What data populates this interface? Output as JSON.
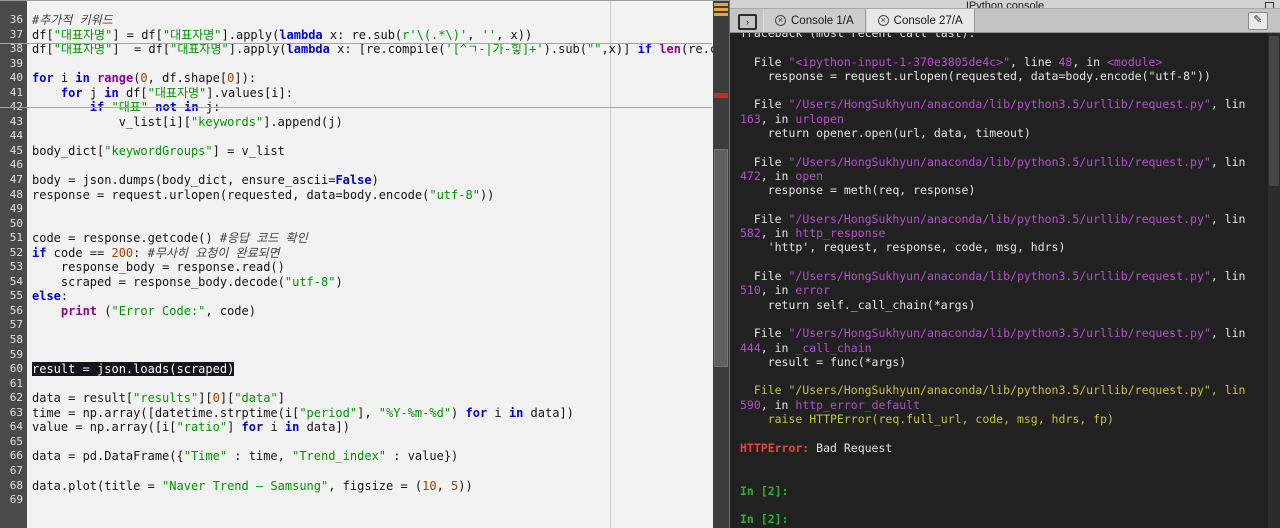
{
  "colors": {
    "ed-bg": "#f2f2f2",
    "ed-gutter-bg": "#4a4a4a",
    "ed-gutter-fg": "#e0e0e0",
    "ed-default": "#141414",
    "ed-keyword": "#0000d0",
    "ed-builtin": "#900090",
    "ed-string": "#009500",
    "ed-number": "#a04000",
    "ed-comment": "#444444",
    "ed-selected-bg": "#14141e",
    "ed-selected-fg": "#ffffff",
    "edge-line": "#cfcfcf",
    "con-bg": "#212121",
    "con-fg": "#e4e4e4",
    "con-magenta": "#b350c9",
    "con-yellow": "#c3c33c",
    "con-red": "#e8453c",
    "con-green": "#2bb52b",
    "titlebar-bg": "#d2d2d2",
    "tabbar-bg": "#c4c4c4",
    "tab-active-bg": "#e7e7e7",
    "tab-inactive-bg": "#cdcdcd",
    "scroll-track": "#3d3d3d",
    "scroll-thumb": "#5f5f5f",
    "warn-orange": "#e8a33d",
    "err-red": "#cc2a2a"
  },
  "editor": {
    "lines": [
      {
        "num": 36,
        "segs": [
          [
            "c",
            "#추가적 키워드"
          ]
        ]
      },
      {
        "num": 37,
        "segs": [
          [
            "d",
            "df["
          ],
          [
            "s",
            "\"대표자명\""
          ],
          [
            "d",
            "] = df["
          ],
          [
            "s",
            "\"대표자명\""
          ],
          [
            "d",
            "].apply("
          ],
          [
            "k",
            "lambda"
          ],
          [
            "d",
            " x: re.sub("
          ],
          [
            "s",
            "r'\\(.*\\)'"
          ],
          [
            "d",
            ", "
          ],
          [
            "s",
            "''"
          ],
          [
            "d",
            ", x))"
          ]
        ]
      },
      {
        "num": 38,
        "segs": [
          [
            "d",
            "df["
          ],
          [
            "s",
            "\"대표자명\""
          ],
          [
            "d",
            "]  = df["
          ],
          [
            "s",
            "\"대표자명\""
          ],
          [
            "d",
            "].apply("
          ],
          [
            "k",
            "lambda"
          ],
          [
            "d",
            " x: [re.compile("
          ],
          [
            "s",
            "'[^ㄱ-|가-힣]+'"
          ],
          [
            "d",
            ").sub("
          ],
          [
            "s",
            "\"\""
          ],
          [
            "d",
            ",x)] "
          ],
          [
            "k",
            "if"
          ],
          [
            "d",
            " "
          ],
          [
            "b",
            "len"
          ],
          [
            "d",
            "(re.c"
          ]
        ]
      },
      {
        "num": 39,
        "segs": []
      },
      {
        "num": 40,
        "segs": [
          [
            "k",
            "for"
          ],
          [
            "d",
            " i "
          ],
          [
            "k",
            "in"
          ],
          [
            "d",
            " "
          ],
          [
            "b",
            "range"
          ],
          [
            "d",
            "("
          ],
          [
            "n",
            "0"
          ],
          [
            "d",
            ", df.shape["
          ],
          [
            "n",
            "0"
          ],
          [
            "d",
            "]):"
          ]
        ]
      },
      {
        "num": 41,
        "segs": [
          [
            "d",
            "    "
          ],
          [
            "k",
            "for"
          ],
          [
            "d",
            " j "
          ],
          [
            "k",
            "in"
          ],
          [
            "d",
            " df["
          ],
          [
            "s",
            "\"대표자명\""
          ],
          [
            "d",
            "].values[i]:"
          ]
        ]
      },
      {
        "num": 42,
        "segs": [
          [
            "d",
            "        "
          ],
          [
            "k",
            "if"
          ],
          [
            "d",
            " "
          ],
          [
            "s",
            "\"대표\""
          ],
          [
            "d",
            " "
          ],
          [
            "k",
            "not"
          ],
          [
            "d",
            " "
          ],
          [
            "k",
            "in"
          ],
          [
            "d",
            " j:"
          ]
        ]
      },
      {
        "num": 43,
        "segs": [
          [
            "d",
            "            v_list[i]["
          ],
          [
            "s",
            "\"keywords\""
          ],
          [
            "d",
            "].append(j)"
          ]
        ]
      },
      {
        "num": 44,
        "segs": []
      },
      {
        "num": 45,
        "segs": [
          [
            "d",
            "body_dict["
          ],
          [
            "s",
            "\"keywordGroups\""
          ],
          [
            "d",
            "] = v_list"
          ]
        ]
      },
      {
        "num": 46,
        "segs": []
      },
      {
        "num": 47,
        "segs": [
          [
            "d",
            "body = json.dumps(body_dict, ensure_ascii="
          ],
          [
            "k",
            "False"
          ],
          [
            "d",
            ")"
          ]
        ]
      },
      {
        "num": 48,
        "segs": [
          [
            "d",
            "response = request.urlopen(requested, data=body.encode("
          ],
          [
            "s",
            "\"utf-8\""
          ],
          [
            "d",
            "))"
          ]
        ]
      },
      {
        "num": 49,
        "segs": []
      },
      {
        "num": 50,
        "segs": []
      },
      {
        "num": 51,
        "segs": [
          [
            "d",
            "code = response.getcode() "
          ],
          [
            "c",
            "#응답 코드 확인"
          ]
        ]
      },
      {
        "num": 52,
        "segs": [
          [
            "k",
            "if"
          ],
          [
            "d",
            " code == "
          ],
          [
            "n",
            "200"
          ],
          [
            "d",
            ": "
          ],
          [
            "c",
            "#무사히 요청이 완료되면"
          ]
        ]
      },
      {
        "num": 53,
        "segs": [
          [
            "d",
            "    response_body = response.read()"
          ]
        ]
      },
      {
        "num": 54,
        "segs": [
          [
            "d",
            "    scraped = response_body.decode("
          ],
          [
            "s",
            "\"utf-8\""
          ],
          [
            "d",
            ")"
          ]
        ]
      },
      {
        "num": 55,
        "segs": [
          [
            "k",
            "else"
          ],
          [
            "d",
            ":"
          ]
        ]
      },
      {
        "num": 56,
        "segs": [
          [
            "d",
            "    "
          ],
          [
            "b",
            "print"
          ],
          [
            "d",
            " ("
          ],
          [
            "s",
            "\"Error Code:\""
          ],
          [
            "d",
            ", code)"
          ]
        ]
      },
      {
        "num": 57,
        "segs": []
      },
      {
        "num": 58,
        "segs": []
      },
      {
        "num": 59,
        "segs": []
      },
      {
        "num": 60,
        "segs": [
          [
            "sel",
            "result = json.loads(scraped)"
          ]
        ]
      },
      {
        "num": 61,
        "segs": []
      },
      {
        "num": 62,
        "segs": [
          [
            "d",
            "data = result["
          ],
          [
            "s",
            "\"results\""
          ],
          [
            "d",
            "]["
          ],
          [
            "n",
            "0"
          ],
          [
            "d",
            "]["
          ],
          [
            "s",
            "\"data\""
          ],
          [
            "d",
            "]"
          ]
        ]
      },
      {
        "num": 63,
        "segs": [
          [
            "d",
            "time = np.array([datetime.strptime(i["
          ],
          [
            "s",
            "\"period\""
          ],
          [
            "d",
            "], "
          ],
          [
            "s",
            "\"%Y-%m-%d\""
          ],
          [
            "d",
            ") "
          ],
          [
            "k",
            "for"
          ],
          [
            "d",
            " i "
          ],
          [
            "k",
            "in"
          ],
          [
            "d",
            " data])"
          ]
        ]
      },
      {
        "num": 64,
        "segs": [
          [
            "d",
            "value = np.array([i["
          ],
          [
            "s",
            "\"ratio\""
          ],
          [
            "d",
            "] "
          ],
          [
            "k",
            "for"
          ],
          [
            "d",
            " i "
          ],
          [
            "k",
            "in"
          ],
          [
            "d",
            " data])"
          ]
        ]
      },
      {
        "num": 65,
        "segs": []
      },
      {
        "num": 66,
        "segs": [
          [
            "d",
            "data = pd.DataFrame({"
          ],
          [
            "s",
            "\"Time\""
          ],
          [
            "d",
            " : time, "
          ],
          [
            "s",
            "\"Trend_index\""
          ],
          [
            "d",
            " : value})"
          ]
        ]
      },
      {
        "num": 67,
        "segs": []
      },
      {
        "num": 68,
        "segs": [
          [
            "d",
            "data.plot(title = "
          ],
          [
            "s",
            "\"Naver Trend – Samsung\""
          ],
          [
            "d",
            ", figsize = ("
          ],
          [
            "n",
            "10"
          ],
          [
            "d",
            ", "
          ],
          [
            "n",
            "5"
          ],
          [
            "d",
            "))"
          ]
        ]
      },
      {
        "num": 69,
        "segs": []
      }
    ]
  },
  "console": {
    "panel_title": "IPython console",
    "tabs": [
      {
        "label": "Console 1/A",
        "active": false
      },
      {
        "label": "Console 27/A",
        "active": true
      }
    ],
    "lines": [
      {
        "clip": true,
        "segs": [
          [
            "w",
            "Traceback (most recent call last):"
          ]
        ]
      },
      {
        "segs": []
      },
      {
        "segs": [
          [
            "w",
            "  File "
          ],
          [
            "m",
            "\"<ipython-input-1-370e3805de4c>\""
          ],
          [
            "w",
            ", line "
          ],
          [
            "m",
            "48"
          ],
          [
            "w",
            ", in "
          ],
          [
            "m",
            "<module>"
          ]
        ]
      },
      {
        "segs": [
          [
            "w",
            "    response = request.urlopen(requested, data=body.encode(\"utf-8\"))"
          ]
        ]
      },
      {
        "segs": []
      },
      {
        "segs": [
          [
            "w",
            "  File "
          ],
          [
            "m",
            "\"/Users/HongSukhyun/anaconda/lib/python3.5/urllib/request.py\""
          ],
          [
            "w",
            ", lin"
          ]
        ]
      },
      {
        "segs": [
          [
            "m",
            "163"
          ],
          [
            "w",
            ", in "
          ],
          [
            "m",
            "urlopen"
          ]
        ]
      },
      {
        "segs": [
          [
            "w",
            "    return opener.open(url, data, timeout)"
          ]
        ]
      },
      {
        "segs": []
      },
      {
        "segs": [
          [
            "w",
            "  File "
          ],
          [
            "m",
            "\"/Users/HongSukhyun/anaconda/lib/python3.5/urllib/request.py\""
          ],
          [
            "w",
            ", lin"
          ]
        ]
      },
      {
        "segs": [
          [
            "m",
            "472"
          ],
          [
            "w",
            ", in "
          ],
          [
            "m",
            "open"
          ]
        ]
      },
      {
        "segs": [
          [
            "w",
            "    response = meth(req, response)"
          ]
        ]
      },
      {
        "segs": []
      },
      {
        "segs": [
          [
            "w",
            "  File "
          ],
          [
            "m",
            "\"/Users/HongSukhyun/anaconda/lib/python3.5/urllib/request.py\""
          ],
          [
            "w",
            ", lin"
          ]
        ]
      },
      {
        "segs": [
          [
            "m",
            "582"
          ],
          [
            "w",
            ", in "
          ],
          [
            "m",
            "http_response"
          ]
        ]
      },
      {
        "segs": [
          [
            "w",
            "    'http', request, response, code, msg, hdrs)"
          ]
        ]
      },
      {
        "segs": []
      },
      {
        "segs": [
          [
            "w",
            "  File "
          ],
          [
            "m",
            "\"/Users/HongSukhyun/anaconda/lib/python3.5/urllib/request.py\""
          ],
          [
            "w",
            ", lin"
          ]
        ]
      },
      {
        "segs": [
          [
            "m",
            "510"
          ],
          [
            "w",
            ", in "
          ],
          [
            "m",
            "error"
          ]
        ]
      },
      {
        "segs": [
          [
            "w",
            "    return self._call_chain(*args)"
          ]
        ]
      },
      {
        "segs": []
      },
      {
        "segs": [
          [
            "w",
            "  File "
          ],
          [
            "m",
            "\"/Users/HongSukhyun/anaconda/lib/python3.5/urllib/request.py\""
          ],
          [
            "w",
            ", lin"
          ]
        ]
      },
      {
        "segs": [
          [
            "m",
            "444"
          ],
          [
            "w",
            ", in "
          ],
          [
            "m",
            "_call_chain"
          ]
        ]
      },
      {
        "segs": [
          [
            "w",
            "    result = func(*args)"
          ]
        ]
      },
      {
        "segs": []
      },
      {
        "segs": [
          [
            "y",
            "  File \"/Users/HongSukhyun/anaconda/lib/python3.5/urllib/request.py\", lin"
          ]
        ]
      },
      {
        "segs": [
          [
            "m",
            "590"
          ],
          [
            "w",
            ", in "
          ],
          [
            "m",
            "http_error_default"
          ]
        ]
      },
      {
        "segs": [
          [
            "y",
            "    raise HTTPError(req.full_url, code, msg, hdrs, fp)"
          ]
        ]
      },
      {
        "segs": []
      },
      {
        "segs": [
          [
            "r",
            "HTTPError:"
          ],
          [
            "w",
            " Bad Request"
          ]
        ]
      },
      {
        "segs": []
      },
      {
        "segs": []
      },
      {
        "segs": [
          [
            "g",
            "In [2]:"
          ]
        ]
      },
      {
        "segs": []
      },
      {
        "segs": [
          [
            "g",
            "In [2]:"
          ]
        ]
      }
    ]
  }
}
